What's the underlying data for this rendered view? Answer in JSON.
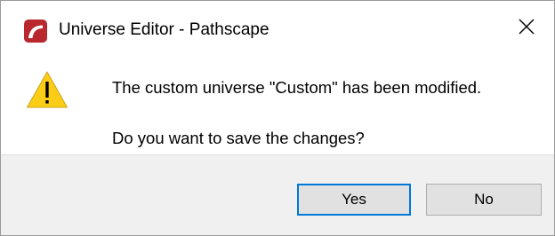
{
  "window": {
    "title": "Universe Editor - Pathscape",
    "app_icon": "pathscape-logo-icon",
    "close_icon": "close-icon"
  },
  "message": {
    "icon": "warning-icon",
    "line1": "The custom universe \"Custom\" has been modified.",
    "line2": "Do you want to save the changes?"
  },
  "buttons": {
    "yes_label": "Yes",
    "no_label": "No"
  },
  "colors": {
    "logo_red": "#b8282e",
    "warning_yellow": "#fccd17",
    "focus_border": "#0078d7",
    "footer_bg": "#f0f0f0"
  }
}
